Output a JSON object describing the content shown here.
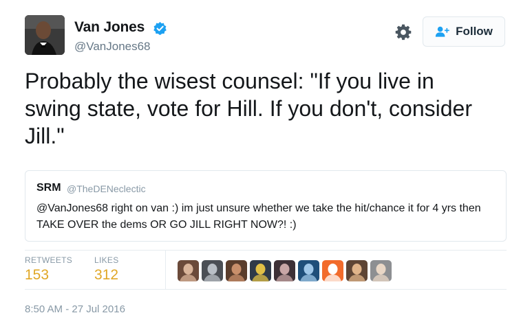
{
  "author": {
    "name": "Van Jones",
    "handle": "@VanJones68",
    "verified": true
  },
  "follow_button": {
    "label": "Follow",
    "icon": "add-user-icon"
  },
  "settings_icon": "gear-icon",
  "tweet": {
    "text": "Probably the wisest counsel: \"If you live in\nswing state, vote for Hill. If you don't, consider\nJill.\""
  },
  "quoted_tweet": {
    "name": "SRM",
    "handle": "@TheDENeclectic",
    "text": "@VanJones68 right on van :) im just unsure whether we take the hit/chance it for 4 yrs then TAKE OVER the dems OR GO JILL RIGHT NOW?! :)"
  },
  "stats": {
    "retweets_label": "RETWEETS",
    "retweets": "153",
    "likes_label": "LIKES",
    "likes": "312"
  },
  "likers": [
    {
      "bg": "#6b4a3a",
      "fg": "#d9b49a"
    },
    {
      "bg": "#4b4f55",
      "fg": "#b9bfc6"
    },
    {
      "bg": "#5a3d2c",
      "fg": "#c98f6b"
    },
    {
      "bg": "#2f3a48",
      "fg": "#e1c046"
    },
    {
      "bg": "#3d3036",
      "fg": "#c8a6a6"
    },
    {
      "bg": "#1f4f7a",
      "fg": "#9fc7e8"
    },
    {
      "bg": "#f26b2b",
      "fg": "#ffffff"
    },
    {
      "bg": "#5e4535",
      "fg": "#e0b48a"
    },
    {
      "bg": "#8d8f92",
      "fg": "#e9d7c6"
    }
  ],
  "timestamp": "8:50 AM - 27 Jul 2016",
  "colors": {
    "accent_gold": "#e0a726",
    "verified_blue": "#1da1f2",
    "muted_text": "#8899a6"
  }
}
